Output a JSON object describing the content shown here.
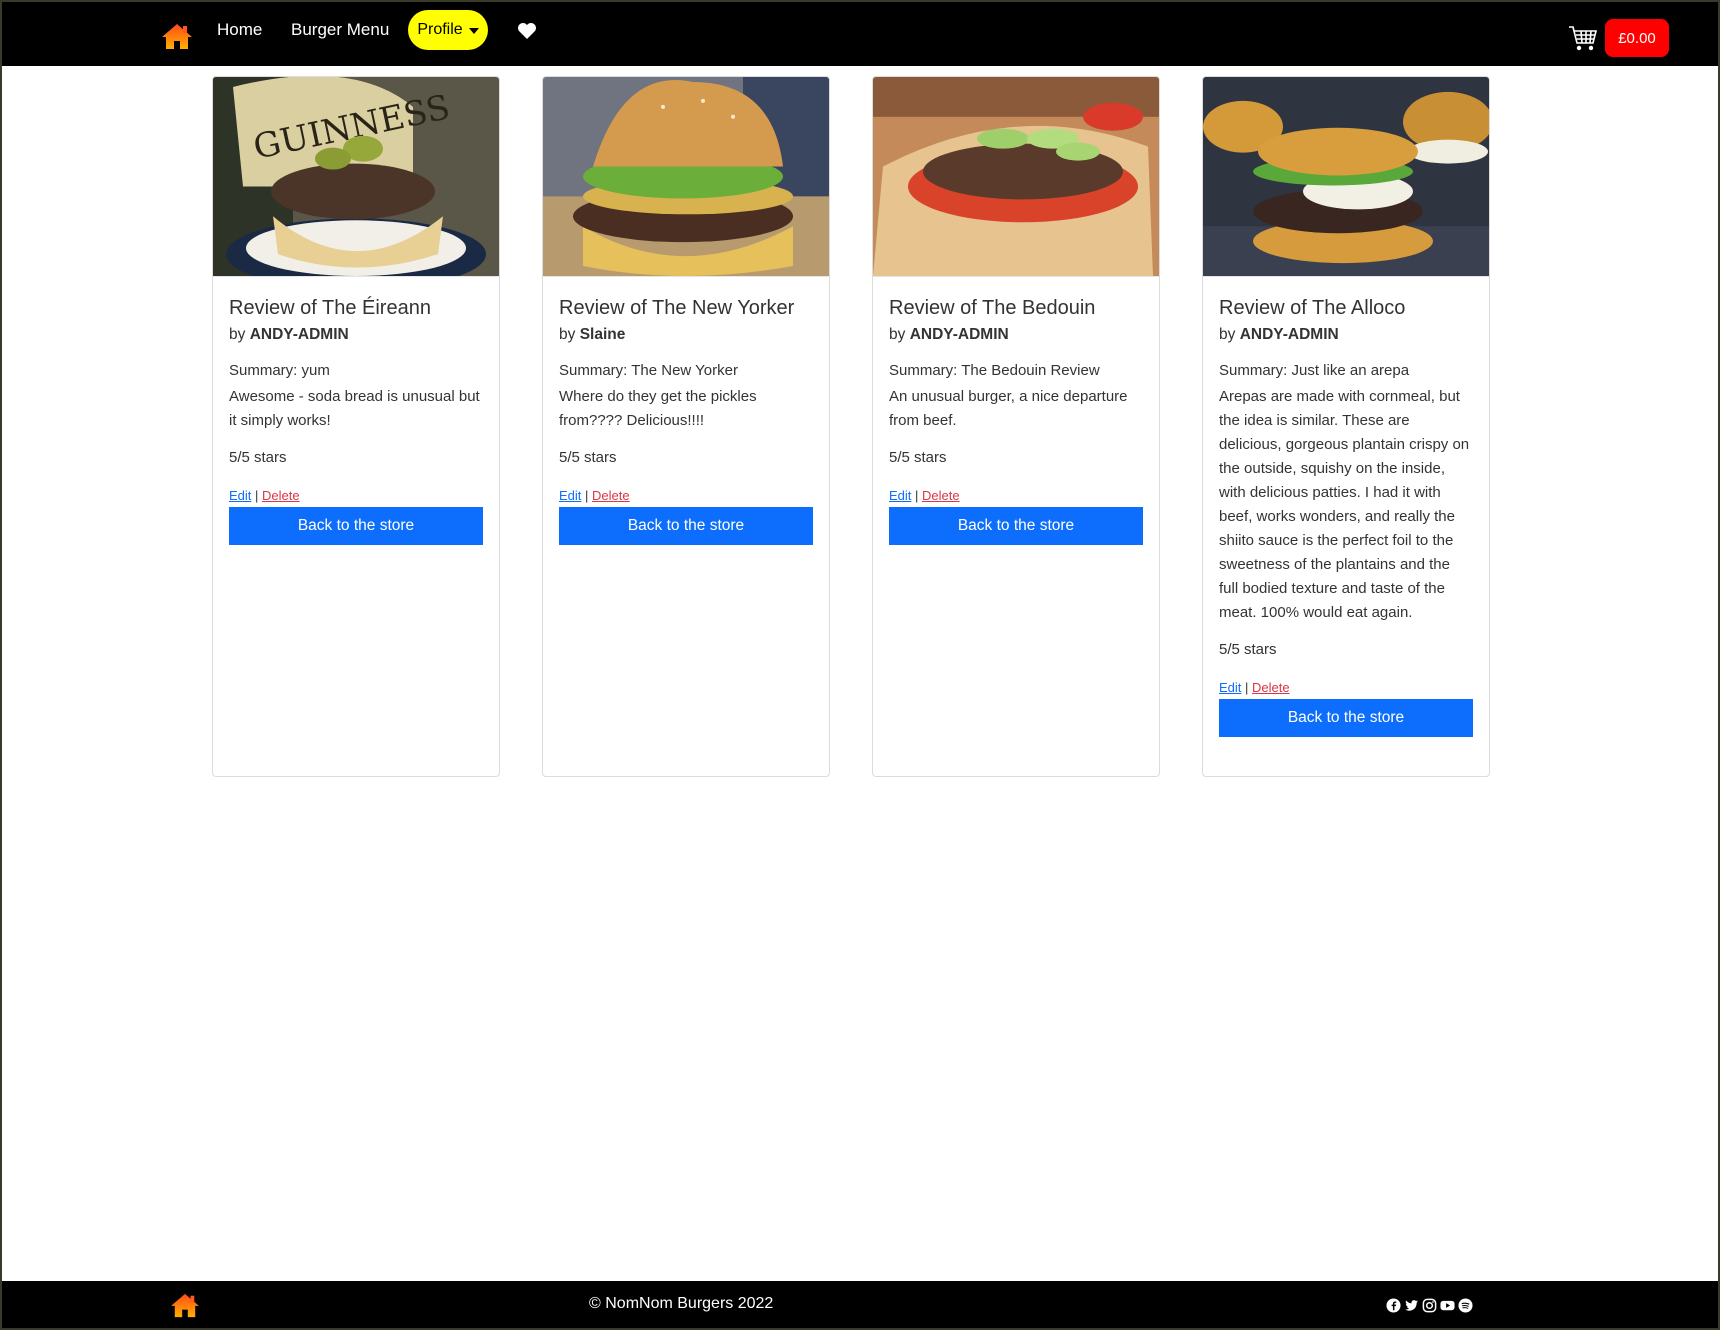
{
  "nav": {
    "home_label": "Home",
    "menu_label": "Burger Menu",
    "profile_label": "Profile",
    "cart_total": "£0.00",
    "brand_color": "#ffff00",
    "cart_color": "#ff0000"
  },
  "reviews": [
    {
      "title": "Review of The Éireann",
      "by": "by",
      "author": "ANDY-ADMIN",
      "summary": "Summary: yum",
      "text": "Awesome - soda bread is unusual but it simply works!",
      "stars": "5/5 stars",
      "edit": "Edit",
      "sep": "|",
      "delete": "Delete",
      "button": "Back to the store"
    },
    {
      "title": "Review of The New Yorker",
      "by": "by",
      "author": "Slaine",
      "summary": "Summary: The New Yorker",
      "text": "Where do they get the pickles from???? Delicious!!!!",
      "stars": "5/5 stars",
      "edit": "Edit",
      "sep": "|",
      "delete": "Delete",
      "button": "Back to the store"
    },
    {
      "title": "Review of The Bedouin",
      "by": "by",
      "author": "ANDY-ADMIN",
      "summary": "Summary: The Bedouin Review",
      "text": "An unusual burger, a nice departure from beef.",
      "stars": "5/5 stars",
      "edit": "Edit",
      "sep": "|",
      "delete": "Delete",
      "button": "Back to the store"
    },
    {
      "title": "Review of The Alloco",
      "by": "by",
      "author": "ANDY-ADMIN",
      "summary": "Summary: Just like an arepa",
      "text": "Arepas are made with cornmeal, but the idea is similar. These are delicious, gorgeous plantain crispy on the outside, squishy on the inside, with delicious patties. I had it with beef, works wonders, and really the shiito sauce is the perfect foil to the sweetness of the plantains and the full bodied texture and taste of the meat. 100% would eat again.",
      "stars": "5/5 stars",
      "edit": "Edit",
      "sep": "|",
      "delete": "Delete",
      "button": "Back to the store"
    }
  ],
  "footer": {
    "copyright": "© NomNom Burgers 2022",
    "social_icons": [
      "facebook-icon",
      "twitter-icon",
      "instagram-icon",
      "youtube-icon",
      "spotify-icon"
    ]
  },
  "accent_color": "#0d6efd"
}
